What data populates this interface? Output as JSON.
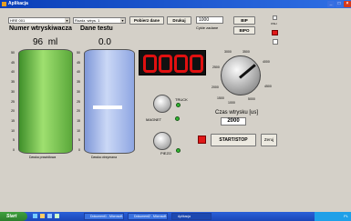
{
  "window": {
    "title": "Aplikacja"
  },
  "toolbar": {
    "combo1": "HRE 001",
    "combo2": "Rozdz. wtrys. 1",
    "fetch_button": "Pobierz dane",
    "print_button": "Drukuj",
    "cycles_value": "1000",
    "cycles_label": "Cykle zadane",
    "btn_bip": "BIP",
    "btn_bipo": "BIPO",
    "osh_label": "OSH"
  },
  "left": {
    "title": "Numer wtryskiwacza",
    "value": "96",
    "unit": "ml",
    "tank_label": "Dawka prawidłowa",
    "ticks": [
      "50",
      "45",
      "40",
      "35",
      "30",
      "25",
      "20",
      "15",
      "10",
      "5",
      "0"
    ]
  },
  "middle": {
    "title": "Dane testu",
    "value": "0.0",
    "tank_label": "Dawka otrzymana",
    "ticks": [
      "50",
      "45",
      "40",
      "35",
      "30",
      "25",
      "20",
      "15",
      "10",
      "5",
      "0"
    ],
    "level_fraction": 0.54
  },
  "display": {
    "digits": "0000"
  },
  "switches": {
    "truck_label": "TRUCK",
    "magnet_label": "MAGNET",
    "piezo_label": "PIEZO"
  },
  "dial": {
    "labels": [
      "3000",
      "3500",
      "4000",
      "4500",
      "5000",
      "2500",
      "2000",
      "1500",
      "1000"
    ],
    "caption": "Czas wtrysku [us]",
    "value": "2000"
  },
  "actions": {
    "start_stop": "START/STOP",
    "reset": "Zeruj"
  },
  "taskbar": {
    "start": "Start",
    "tasks": [
      "Dokument1 - Microsoft...",
      "Dokument2 - Microsoft...",
      "Aplikacja"
    ],
    "tray_text": "PL"
  },
  "colors": {
    "green_tank": "#6fc24a",
    "blue_tank": "#a9bde8",
    "led": "#2fb82f",
    "display_red": "#e01010",
    "stop_red": "#e01818"
  }
}
